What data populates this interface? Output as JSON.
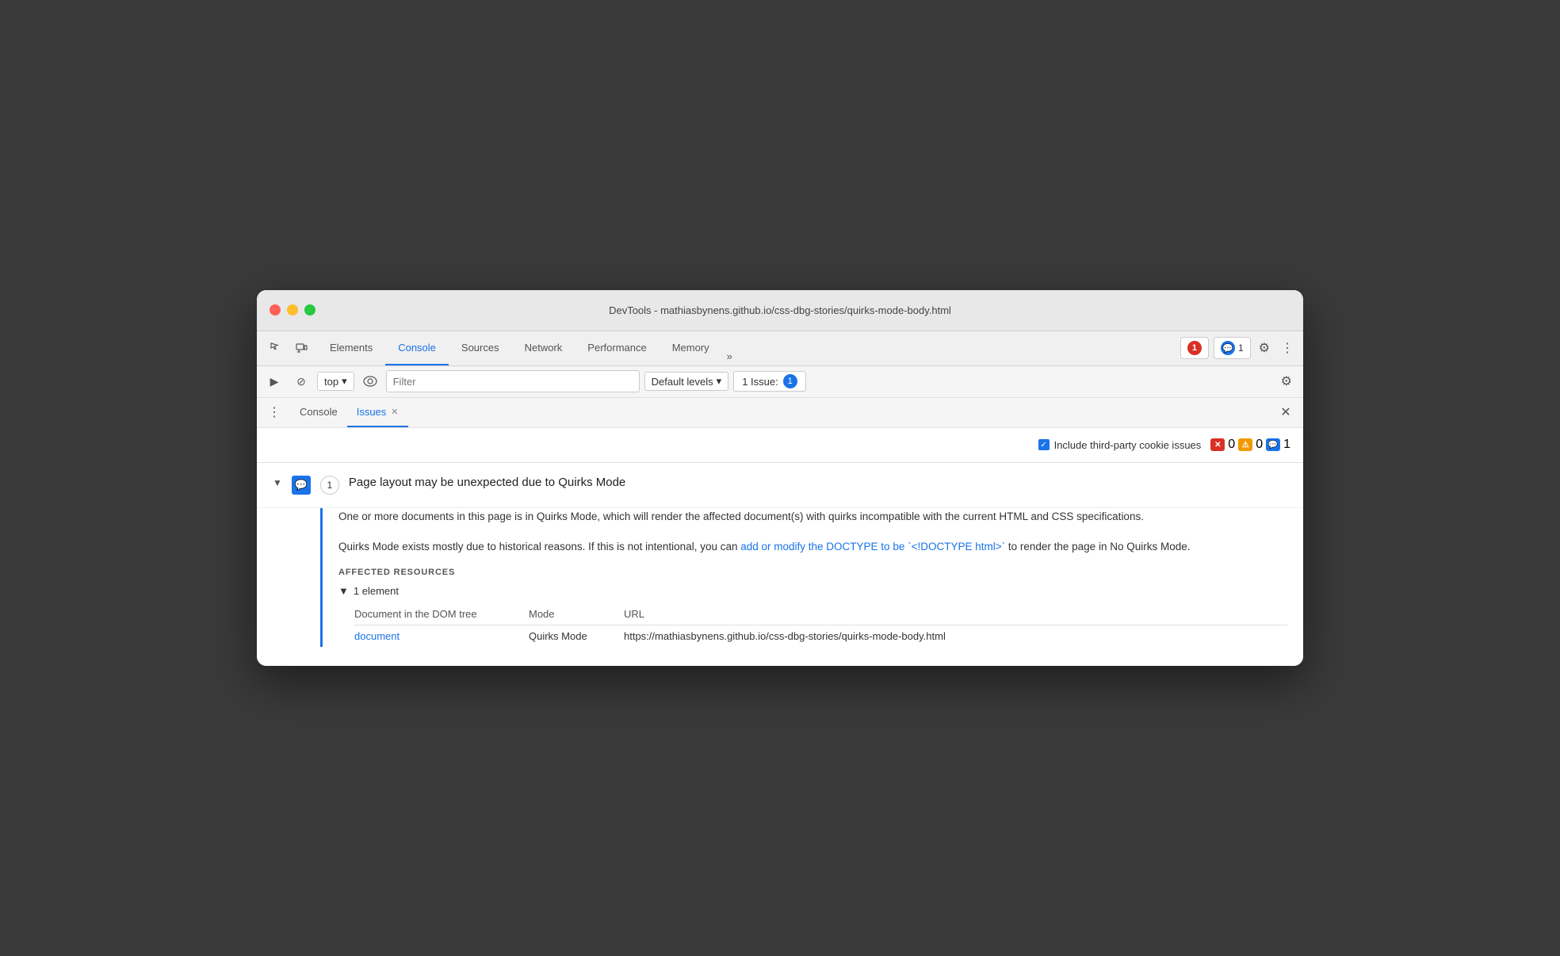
{
  "window": {
    "title": "DevTools - mathiasbynens.github.io/css-dbg-stories/quirks-mode-body.html"
  },
  "devtools_tabs": {
    "items": [
      {
        "id": "elements",
        "label": "Elements",
        "active": false
      },
      {
        "id": "console",
        "label": "Console",
        "active": true
      },
      {
        "id": "sources",
        "label": "Sources",
        "active": false
      },
      {
        "id": "network",
        "label": "Network",
        "active": false
      },
      {
        "id": "performance",
        "label": "Performance",
        "active": false
      },
      {
        "id": "memory",
        "label": "Memory",
        "active": false
      }
    ],
    "more_label": "»",
    "error_count": "1",
    "message_count": "1",
    "gear_icon": "⚙",
    "dots_icon": "⋮"
  },
  "console_toolbar": {
    "play_icon": "▶",
    "block_icon": "⊘",
    "top_label": "top",
    "chevron_icon": "▾",
    "eye_icon": "👁",
    "filter_placeholder": "Filter",
    "levels_label": "Default levels",
    "levels_chevron": "▾",
    "issues_label": "1 Issue:",
    "issues_count": "1",
    "gear_icon": "⚙"
  },
  "panel_tabs": {
    "dots_icon": "⋮",
    "tabs": [
      {
        "id": "console-tab",
        "label": "Console",
        "active": false,
        "closeable": false
      },
      {
        "id": "issues-tab",
        "label": "Issues",
        "active": true,
        "closeable": true
      }
    ],
    "close_icon": "✕"
  },
  "issues_header": {
    "checkbox_label": "Include third-party cookie issues",
    "error_count": "0",
    "warning_count": "0",
    "info_count": "1"
  },
  "issue": {
    "title": "Page layout may be unexpected due to Quirks Mode",
    "count": "1",
    "description_part1": "One or more documents in this page is in Quirks Mode, which will render the affected document(s) with quirks incompatible with the current HTML and CSS specifications.",
    "description_part2_before": "Quirks Mode exists mostly due to historical reasons. If this is not intentional, you can ",
    "description_link": "add or modify the DOCTYPE to be `<!DOCTYPE html>`",
    "description_part2_after": " to render the page in No Quirks Mode.",
    "affected_resources_label": "AFFECTED RESOURCES",
    "element_count_label": "1 element",
    "col_document": "Document in the DOM tree",
    "col_mode": "Mode",
    "col_url": "URL",
    "row_link": "document",
    "row_mode": "Quirks Mode",
    "row_url": "https://mathiasbynens.github.io/css-dbg-stories/quirks-mode-body.html"
  }
}
